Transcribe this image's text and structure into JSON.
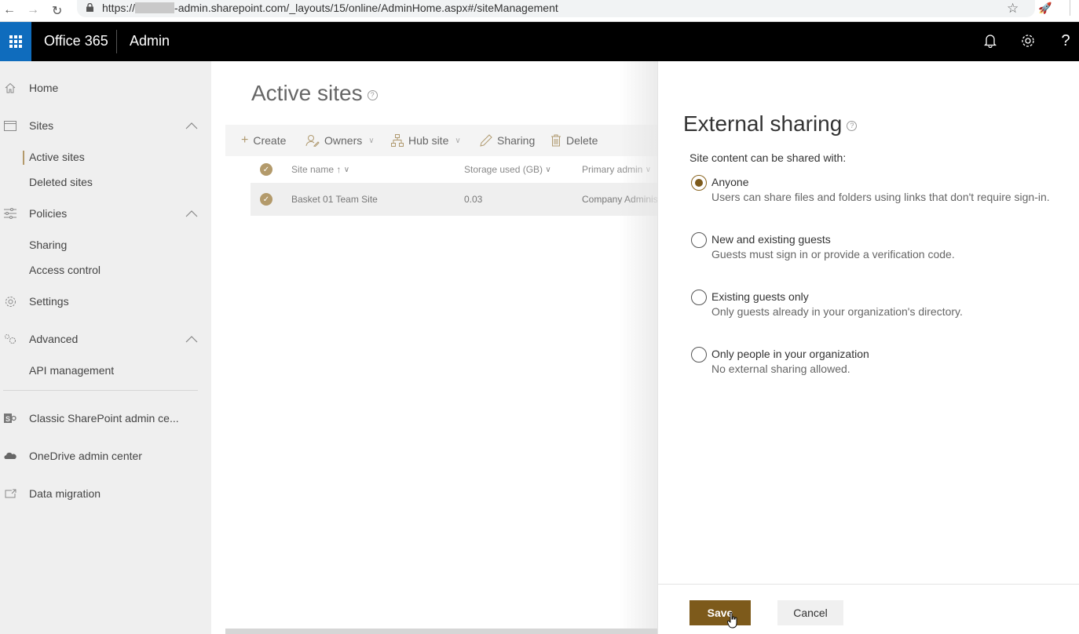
{
  "browser": {
    "url_prefix": "https://",
    "url_suffix": "-admin.sharepoint.com/_layouts/15/online/AdminHome.aspx#/siteManagement"
  },
  "suite": {
    "brand": "Office 365",
    "app": "Admin",
    "icons": [
      "app-launcher-icon",
      "bell-icon",
      "gear-icon",
      "help-icon"
    ],
    "help_glyph": "?"
  },
  "sidebar": {
    "items": [
      {
        "label": "Home",
        "icon": "home-icon"
      },
      {
        "label": "Sites",
        "icon": "sites-icon",
        "expanded": true
      },
      {
        "label": "Active sites",
        "active": true
      },
      {
        "label": "Deleted sites"
      },
      {
        "label": "Policies",
        "icon": "policies-icon",
        "expanded": true
      },
      {
        "label": "Sharing"
      },
      {
        "label": "Access control"
      },
      {
        "label": "Settings",
        "icon": "settings-icon"
      },
      {
        "label": "Advanced",
        "icon": "advanced-icon",
        "expanded": true
      },
      {
        "label": "API management"
      },
      {
        "label": "Classic SharePoint admin ce...",
        "icon": "sharepoint-icon"
      },
      {
        "label": "OneDrive admin center",
        "icon": "onedrive-icon"
      },
      {
        "label": "Data migration",
        "icon": "data-migration-icon"
      }
    ]
  },
  "main": {
    "title": "Active sites",
    "commands": [
      {
        "label": "Create",
        "icon": "plus-icon"
      },
      {
        "label": "Owners",
        "icon": "owners-icon",
        "dropdown": true
      },
      {
        "label": "Hub site",
        "icon": "hub-site-icon",
        "dropdown": true
      },
      {
        "label": "Sharing",
        "icon": "pencil-icon"
      },
      {
        "label": "Delete",
        "icon": "trash-icon"
      }
    ],
    "columns": [
      "Site name",
      "Storage used (GB)",
      "Primary admin"
    ],
    "rows": [
      {
        "site_name": "Basket 01 Team Site",
        "storage": "0.03",
        "admin": "Company Adminis"
      }
    ]
  },
  "panel": {
    "title": "External sharing",
    "subtitle": "Site content can be shared with:",
    "selected": 0,
    "options": [
      {
        "label": "Anyone",
        "desc": "Users can share files and folders using links that don't require sign-in."
      },
      {
        "label": "New and existing guests",
        "desc": "Guests must sign in or provide a verification code."
      },
      {
        "label": "Existing guests only",
        "desc": "Only guests already in your organization's directory."
      },
      {
        "label": "Only people in your organization",
        "desc": "No external sharing allowed."
      }
    ],
    "save_label": "Save",
    "cancel_label": "Cancel"
  },
  "colors": {
    "accent": "#7d5a1b",
    "accent_light": "#b39a6b",
    "suite_bar": "#000000",
    "waffle": "#0f6cbd"
  }
}
